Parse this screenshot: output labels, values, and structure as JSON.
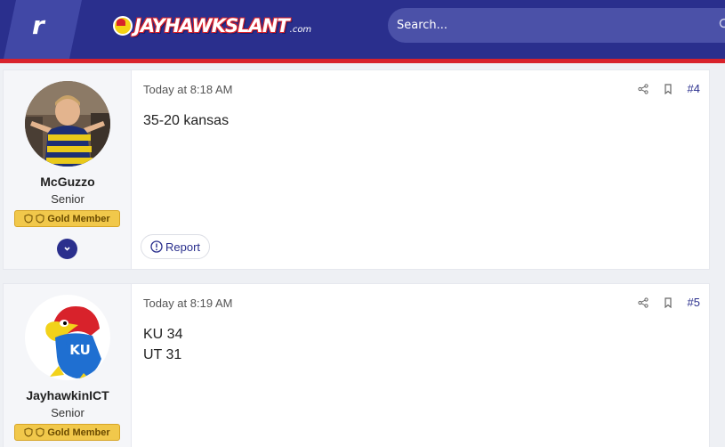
{
  "header": {
    "rivals_mark": "r",
    "site_name": "JAYHAWKSLANT",
    "site_tld": ".com",
    "search_placeholder": "Search..."
  },
  "posts": [
    {
      "author": "McGuzzo",
      "user_title": "Senior",
      "badge": "Gold Member",
      "timestamp": "Today at 8:18 AM",
      "post_number": "#4",
      "body_lines": [
        "35-20 kansas"
      ],
      "report_label": "Report"
    },
    {
      "author": "JayhawkinICT",
      "user_title": "Senior",
      "badge": "Gold Member",
      "avatar_text": "KU",
      "timestamp": "Today at 8:19 AM",
      "post_number": "#5",
      "body_lines": [
        "KU 34",
        "UT 31"
      ]
    }
  ],
  "colors": {
    "header_bg": "#2a2f8d",
    "header_stripe": "#d8222b",
    "gold_badge": "#f1c84b",
    "link": "#2a2f8d"
  },
  "icons": [
    "search-icon",
    "share-icon",
    "bookmark-icon",
    "info-icon",
    "chevron-down-icon",
    "shield-icon"
  ]
}
